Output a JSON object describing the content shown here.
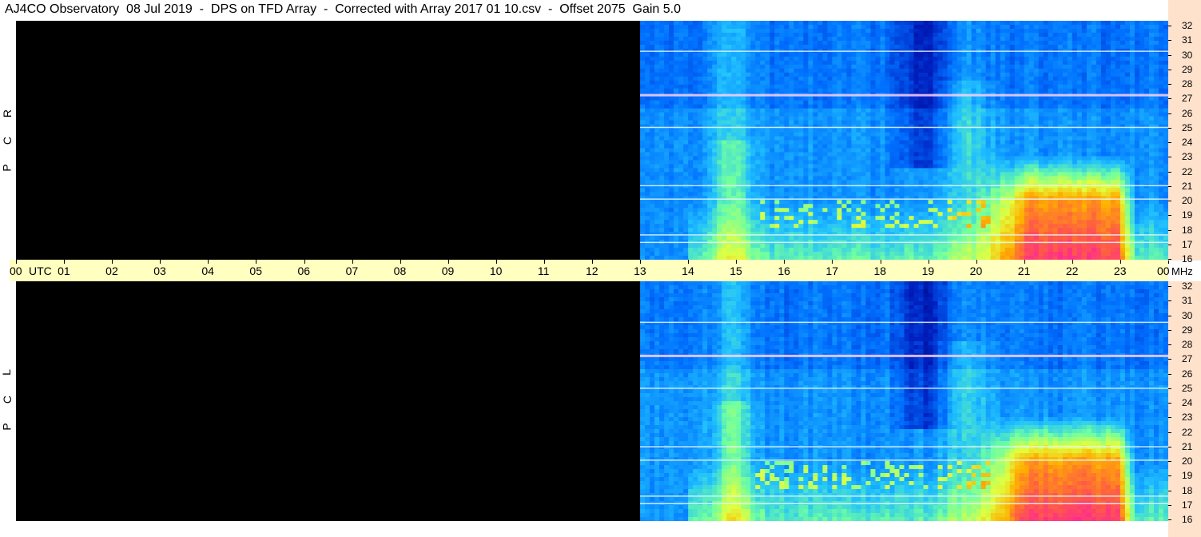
{
  "title": "AJ4CO Observatory  08 Jul 2019  -  DPS on TFD Array  -  Corrected with Array 2017 01 10.csv  -  Offset 2075  Gain 5.0",
  "chart_data": [
    {
      "type": "heatmap",
      "panel": "RCP",
      "polarization_label": [
        "R",
        "C",
        "P"
      ],
      "x_axis": "UTC hours",
      "x_range": [
        0,
        24
      ],
      "y_axis": "MHz",
      "y_range": [
        16,
        32
      ],
      "no_data_until_utc": 13,
      "features": {
        "background_band_utc": [
          14.7,
          15.2
        ],
        "strong_emission_utc": [
          20.5,
          23.3
        ],
        "strong_emission_mhz": [
          16,
          22
        ],
        "interference_lines_mhz": [
          17.2,
          17.7,
          20.1,
          21.0,
          24.9,
          27.1,
          30.0
        ]
      }
    },
    {
      "type": "heatmap",
      "panel": "LCP",
      "polarization_label": [
        "L",
        "C",
        "P"
      ],
      "x_axis": "UTC hours",
      "x_range": [
        0,
        24
      ],
      "y_axis": "MHz",
      "y_range": [
        16,
        32
      ],
      "no_data_until_utc": 13,
      "features": {
        "background_band_utc": [
          14.7,
          15.2
        ],
        "strong_emission_utc": [
          20.5,
          23.3
        ],
        "strong_emission_mhz": [
          16,
          22
        ],
        "interference_lines_mhz": [
          17.2,
          17.7,
          20.1,
          21.0,
          24.9,
          27.1,
          29.3
        ]
      }
    }
  ],
  "time_axis": {
    "labels": [
      "00",
      "01",
      "02",
      "03",
      "04",
      "05",
      "06",
      "07",
      "08",
      "09",
      "10",
      "11",
      "12",
      "13",
      "14",
      "15",
      "16",
      "17",
      "18",
      "19",
      "20",
      "21",
      "22",
      "23",
      "00"
    ],
    "utc_label": "UTC",
    "unit_label": "MHz"
  },
  "freq_axis": {
    "labels": [
      "32",
      "31",
      "30",
      "29",
      "28",
      "27",
      "26",
      "25",
      "24",
      "23",
      "22",
      "21",
      "20",
      "19",
      "18",
      "17",
      "16"
    ]
  },
  "colors": {
    "no_data": "#000000",
    "time_axis_bg": "#ffffc0",
    "freq_axis_bg": "#ffe2cc",
    "colormap": [
      "#00006a",
      "#0020c0",
      "#0070ff",
      "#20c0ff",
      "#70ffa0",
      "#e0ff40",
      "#ffb000",
      "#ff6040",
      "#ff20a0",
      "#ffffff"
    ]
  }
}
